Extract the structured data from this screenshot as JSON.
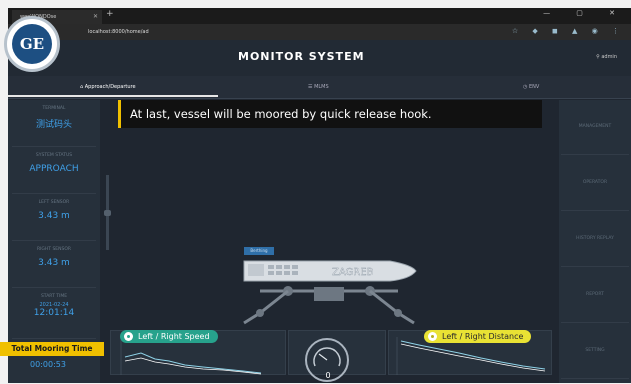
{
  "browser": {
    "tab_title": "weeWONDOse",
    "url": "localhost:8000/home/ad",
    "window_controls": "— ▢ ✕"
  },
  "logo": {
    "text": "GE"
  },
  "header": {
    "title": "MONITOR SYSTEM",
    "user": "admin"
  },
  "nav": {
    "tabs": [
      {
        "label": "Approach/Departure",
        "active": true
      },
      {
        "label": "MLMS",
        "active": false
      },
      {
        "label": "ENV",
        "active": false
      }
    ]
  },
  "left_panel": {
    "terminal_label": "TERMINAL",
    "terminal_value": "测试码头",
    "system_status_label": "SYSTEM STATUS",
    "system_status_value": "APPROACH",
    "left_sensor_label": "LEFT SENSOR",
    "left_sensor_value": "3.43 m",
    "right_sensor_label": "RIGHT SENSOR",
    "right_sensor_value": "3.43 m",
    "start_time_label": "START TIME",
    "start_date": "2021-02-24",
    "start_time": "12:01:14",
    "total_mooring_label": "Total Mooring Time",
    "total_mooring_value": "00:00:53"
  },
  "right_panel": {
    "buttons": [
      "MANAGEMENT",
      "OPERATOR",
      "HISTORY REPLAY",
      "REPORT",
      "SETTING"
    ]
  },
  "main": {
    "caption": "At last, vessel will be moored by quick release hook.",
    "ship_tag": "Berthing",
    "ship_name": "ZAGREB",
    "speed_panel_label": "Left / Right Speed",
    "distance_panel_label": "Left / Right Distance",
    "gauge_value": "0"
  },
  "colors": {
    "accent_blue": "#3fa0e8",
    "caption_border": "#f0c000",
    "pill_green": "#27a28c",
    "pill_yellow": "#e9e234"
  }
}
